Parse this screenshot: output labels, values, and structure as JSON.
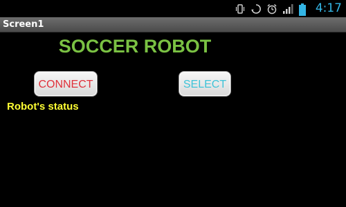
{
  "status_bar": {
    "time": "4:17",
    "icons": [
      "vibrate-icon",
      "sync-icon",
      "alarm-icon",
      "signal-icon",
      "battery-icon"
    ],
    "time_color": "#33b5e5"
  },
  "window": {
    "title": "Screen1"
  },
  "main": {
    "app_title": "SOCCER ROBOT",
    "connect_label": "CONNECT",
    "select_label": "SELECT",
    "robot_status_label": "Robot's status"
  },
  "colors": {
    "title_green": "#7ac143",
    "connect_red": "#e0303a",
    "select_cyan": "#3ec3d8",
    "status_yellow": "#ffff33"
  }
}
